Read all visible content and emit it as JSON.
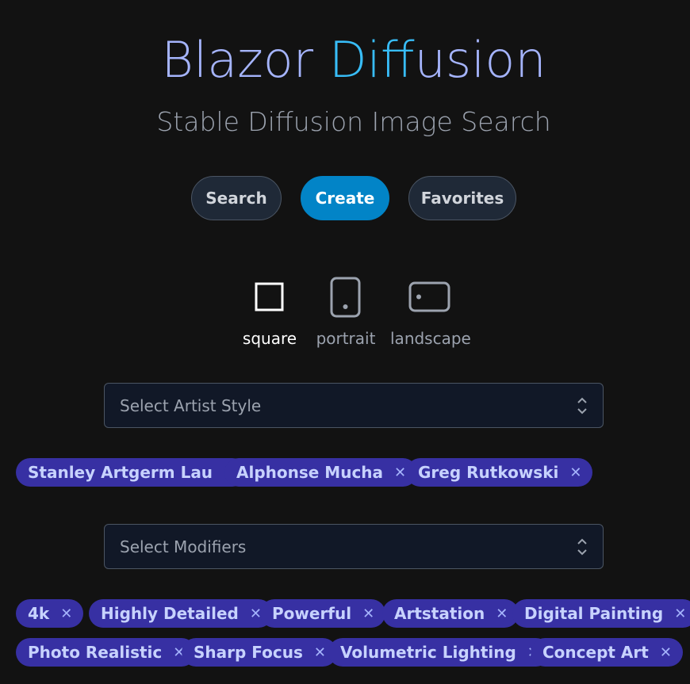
{
  "header": {
    "title_part1": "Blazor ",
    "title_part2": "Diff",
    "title_part3": "usion",
    "subtitle": "Stable Diffusion Image Search"
  },
  "nav": {
    "search": "Search",
    "create": "Create",
    "favorites": "Favorites"
  },
  "orientation": {
    "square": "square",
    "portrait": "portrait",
    "landscape": "landscape",
    "selected": "square"
  },
  "artist_select": {
    "placeholder": "Select Artist Style",
    "chips": [
      "Stanley Artgerm Lau",
      "Alphonse Mucha",
      "Greg Rutkowski"
    ]
  },
  "modifier_select": {
    "placeholder": "Select Modifiers",
    "chips_row1": [
      "4k",
      "Highly Detailed",
      "Powerful",
      "Artstation",
      "Digital Painting"
    ],
    "chips_row2": [
      "Photo Realistic",
      "Sharp Focus",
      "Volumetric Lighting",
      "Concept Art"
    ]
  },
  "chip_remove_glyph": "✕",
  "colors": {
    "accent": "#0284c7",
    "chip_bg": "#3730a3",
    "title_a": "#a5b4fc",
    "title_b": "#38bdf8"
  }
}
